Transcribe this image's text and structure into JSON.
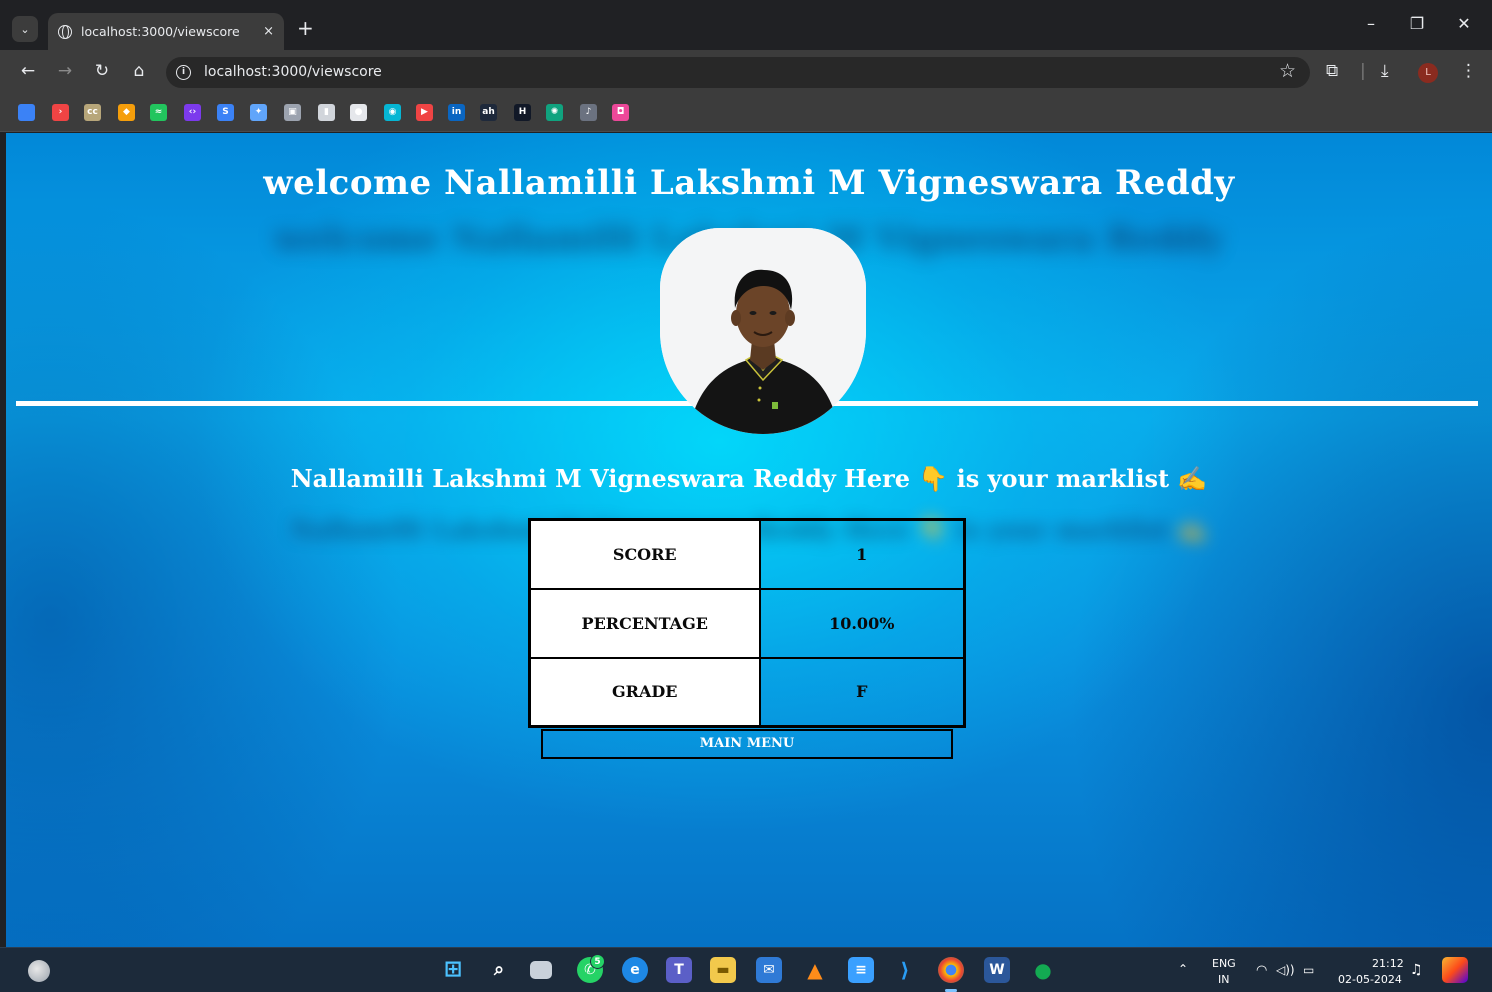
{
  "browser": {
    "tab_title": "localhost:3000/viewscore",
    "tab_close": "×",
    "new_tab": "+",
    "url": "localhost:3000/viewscore",
    "profile_initial": "L"
  },
  "bookmarks": [
    {
      "name": "bookmark-1",
      "glyph": "",
      "color": "#3b82f6"
    },
    {
      "name": "bookmark-2",
      "glyph": "›",
      "color": "#ef4444"
    },
    {
      "name": "bookmark-cc",
      "glyph": "cc",
      "color": "#b7a67a"
    },
    {
      "name": "bookmark-4",
      "glyph": "◆",
      "color": "#f59e0b"
    },
    {
      "name": "bookmark-5",
      "glyph": "≈",
      "color": "#22c55e"
    },
    {
      "name": "bookmark-6",
      "glyph": "‹›",
      "color": "#7c3aed"
    },
    {
      "name": "bookmark-s",
      "glyph": "S",
      "color": "#3b82f6"
    },
    {
      "name": "bookmark-gemini",
      "glyph": "✦",
      "color": "#60a5fa"
    },
    {
      "name": "bookmark-9",
      "glyph": "▣",
      "color": "#9ca3af"
    },
    {
      "name": "bookmark-10",
      "glyph": "▮",
      "color": "#d1d5db"
    },
    {
      "name": "bookmark-github",
      "glyph": "●",
      "color": "#e5e7eb"
    },
    {
      "name": "bookmark-12",
      "glyph": "◉",
      "color": "#06b6d4"
    },
    {
      "name": "bookmark-youtube",
      "glyph": "▶",
      "color": "#ef4444"
    },
    {
      "name": "bookmark-linkedin",
      "glyph": "in",
      "color": "#0a66c2"
    },
    {
      "name": "bookmark-15",
      "glyph": "ah",
      "color": "#1e293b"
    },
    {
      "name": "bookmark-16",
      "glyph": "H",
      "color": "#111827"
    },
    {
      "name": "bookmark-chatgpt",
      "glyph": "✺",
      "color": "#10a37f"
    },
    {
      "name": "bookmark-18",
      "glyph": "♪",
      "color": "#6b7280"
    },
    {
      "name": "bookmark-19",
      "glyph": "◘",
      "color": "#ec4899"
    }
  ],
  "page": {
    "welcome": "welcome Nallamilli Lakshmi M Vigneswara Reddy",
    "marklist_heading": "Nallamilli Lakshmi M Vigneswara Reddy Here 👇 is your marklist ✍️",
    "table": [
      {
        "label": "SCORE",
        "value": "1"
      },
      {
        "label": "PERCENTAGE",
        "value": "10.00%"
      },
      {
        "label": "GRADE",
        "value": "F"
      }
    ],
    "main_menu": "MAIN MENU"
  },
  "taskbar": {
    "whatsapp_badge": "5",
    "language_top": "ENG",
    "language_bottom": "IN",
    "time": "21:12",
    "date": "02-05-2024"
  }
}
